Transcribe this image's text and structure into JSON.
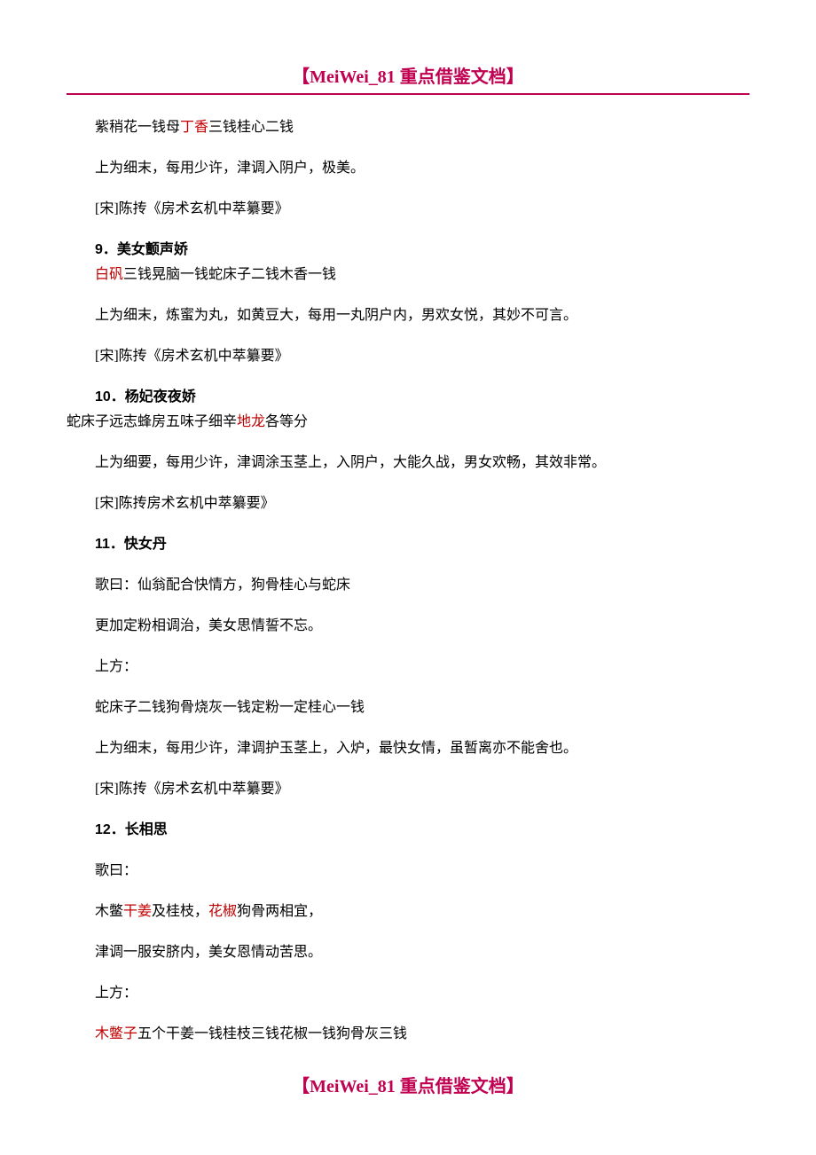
{
  "header": "【MeiWei_81 重点借鉴文档】",
  "footer": "【MeiWei_81 重点借鉴文档】",
  "p1": {
    "t1": "紫稍花一钱母",
    "r1": "丁香",
    "t2": "三钱桂心二钱"
  },
  "p2": "上为细末，每用少许，津调入阴户，极美。",
  "p3": "[宋]陈抟《房术玄机中萃纂要》",
  "h9": "9．美女颤声娇",
  "p4": {
    "r1": "白矾",
    "t1": "三钱晃脑一钱蛇床子二钱木香一钱"
  },
  "p5": "上为细末，炼蜜为丸，如黄豆大，每用一丸阴户内，男欢女悦，其妙不可言。",
  "p6": "[宋]陈抟《房术玄机中萃纂要》",
  "h10": "10．杨妃夜夜娇",
  "p7": {
    "t1": "蛇床子远志蜂房五味子细辛",
    "r1": "地龙",
    "t2": "各等分"
  },
  "p8": "上为细要，每用少许，津调涂玉茎上，入阴户，大能久战，男女欢畅，其效非常。",
  "p9": "[宋]陈抟房术玄机中萃纂要》",
  "h11": "11．快女丹",
  "p10": "歌曰：仙翁配合快情方，狗骨桂心与蛇床",
  "p11": "更加定粉相调治，美女思情誓不忘。",
  "p12": "上方：",
  "p13": "蛇床子二钱狗骨烧灰一钱定粉一定桂心一钱",
  "p14": "上为细末，每用少许，津调护玉茎上，入炉，最快女情，虽暂离亦不能舍也。",
  "p15": "[宋]陈抟《房术玄机中萃纂要》",
  "h12": "12．长相思",
  "p16": "歌曰：",
  "p17": {
    "t1": "木鳖",
    "r1": "干姜",
    "t2": "及桂枝，",
    "r2": "花椒",
    "t3": "狗骨两相宜，"
  },
  "p18": "津调一服安脐内，美女恩情动苦思。",
  "p19": "上方：",
  "p20": {
    "r1": "木鳖子",
    "t1": "五个干姜一钱桂枝三钱花椒一钱狗骨灰三钱"
  }
}
